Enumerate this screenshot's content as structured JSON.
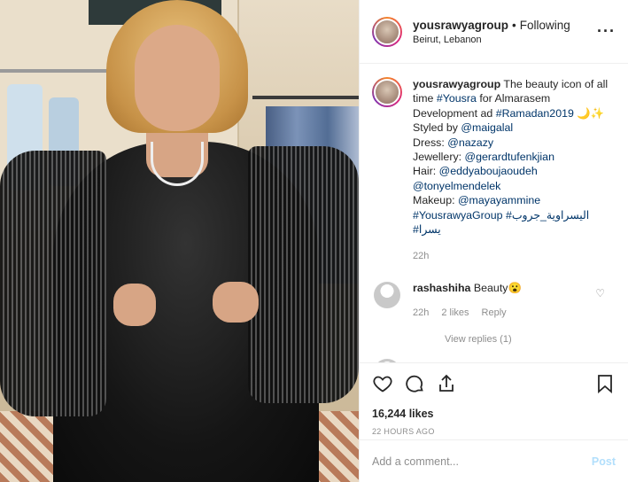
{
  "post": {
    "username": "yousrawyagroup",
    "separator": "•",
    "follow_status": "Following",
    "location": "Beirut, Lebanon",
    "more_icon": "more-horizontal-icon"
  },
  "caption": {
    "username": "yousrawyagroup",
    "segments": {
      "s1": "The beauty icon of all time ",
      "l1": "#Yousra",
      "s2": " for Almarasem Development ad ",
      "l2": "#Ramadan2019",
      "s3": " 🌙✨",
      "s4": "Styled by ",
      "l3": "@maigalal",
      "s5": "Dress: ",
      "l4": "@nazazy",
      "s6": "Jewellery: ",
      "l5": "@gerardtufenkjian",
      "s7": "Hair: ",
      "l6": "@eddyaboujaoudeh",
      "l7": "@tonyelmendelek",
      "s8": "Makeup: ",
      "l8": "@mayayammine",
      "l9": "#YousrawyaGroup",
      "l10": "#اليسراوية_جروب",
      "l11": "#يسرا"
    },
    "time": "22h"
  },
  "comments": [
    {
      "username": "rashashiha",
      "text": "Beauty😮",
      "time": "22h",
      "likes": "2 likes",
      "reply": "Reply",
      "view_replies": "View replies (1)"
    }
  ],
  "partial_comment": "...",
  "actions": {
    "like_icon": "heart-icon",
    "comment_icon": "comment-icon",
    "share_icon": "share-icon",
    "save_icon": "bookmark-icon"
  },
  "likes_count": "16,244 likes",
  "time_ago": "22 HOURS AGO",
  "add_comment": {
    "placeholder": "Add a comment...",
    "post_label": "Post"
  },
  "colors": {
    "link": "#003569",
    "muted": "#8e8e8e",
    "post_disabled": "#b2dffc"
  }
}
